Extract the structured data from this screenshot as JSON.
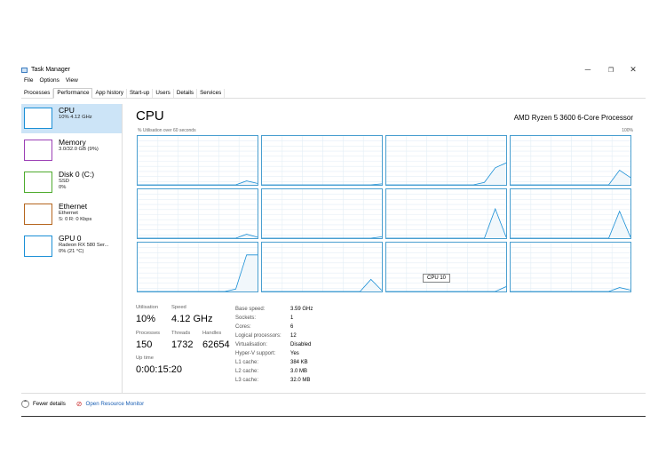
{
  "window": {
    "title": "Task Manager",
    "minimize": "─",
    "maximize": "❐",
    "close": "✕"
  },
  "menu": [
    "File",
    "Options",
    "View"
  ],
  "tabs": [
    "Processes",
    "Performance",
    "App history",
    "Start-up",
    "Users",
    "Details",
    "Services"
  ],
  "active_tab": 1,
  "sidebar": [
    {
      "title": "CPU",
      "sub1": "10% 4.12 GHz",
      "sub2": "",
      "color": "#1a8fd6"
    },
    {
      "title": "Memory",
      "sub1": "3.0/32.0 GB (9%)",
      "sub2": "",
      "color": "#9b3fb5"
    },
    {
      "title": "Disk 0 (C:)",
      "sub1": "SSD",
      "sub2": "0%",
      "color": "#4daa2c"
    },
    {
      "title": "Ethernet",
      "sub1": "Ethernet",
      "sub2": "S: 0 R: 0 Kbps",
      "color": "#b5651d"
    },
    {
      "title": "GPU 0",
      "sub1": "Radeon RX 580 Ser...",
      "sub2": "0% (21 °C)",
      "color": "#1a8fd6"
    }
  ],
  "main": {
    "title": "CPU",
    "processor": "AMD Ryzen 5 3600 6-Core Processor",
    "axis_label": "% Utilisation over 60 seconds",
    "axis_max": "100%",
    "tooltip": "CPU 10",
    "cores": [
      [
        0,
        0,
        0,
        0,
        0,
        0,
        0,
        0,
        0,
        0,
        8,
        3
      ],
      [
        0,
        0,
        0,
        0,
        0,
        0,
        0,
        0,
        0,
        0,
        0,
        2
      ],
      [
        0,
        0,
        0,
        0,
        0,
        0,
        0,
        0,
        0,
        5,
        35,
        45
      ],
      [
        0,
        0,
        0,
        0,
        0,
        0,
        0,
        0,
        0,
        0,
        30,
        15
      ],
      [
        0,
        0,
        0,
        0,
        0,
        0,
        0,
        0,
        0,
        0,
        8,
        2
      ],
      [
        0,
        0,
        0,
        0,
        0,
        0,
        0,
        0,
        0,
        0,
        0,
        3
      ],
      [
        0,
        0,
        0,
        0,
        0,
        0,
        0,
        0,
        0,
        0,
        60,
        2
      ],
      [
        0,
        0,
        0,
        0,
        0,
        0,
        0,
        0,
        0,
        0,
        55,
        2
      ],
      [
        0,
        0,
        0,
        0,
        0,
        0,
        0,
        0,
        0,
        5,
        75,
        75
      ],
      [
        0,
        0,
        0,
        0,
        0,
        0,
        0,
        0,
        0,
        0,
        25,
        2
      ],
      [
        0,
        0,
        0,
        0,
        0,
        0,
        0,
        0,
        0,
        0,
        0,
        10
      ],
      [
        0,
        0,
        0,
        0,
        0,
        0,
        0,
        0,
        0,
        0,
        8,
        3
      ]
    ],
    "stats": {
      "utilisation_label": "Utilisation",
      "utilisation": "10%",
      "speed_label": "Speed",
      "speed": "4.12 GHz",
      "processes_label": "Processes",
      "processes": "150",
      "threads_label": "Threads",
      "threads": "1732",
      "handles_label": "Handles",
      "handles": "62654",
      "uptime_label": "Up time",
      "uptime": "0:00:15:20"
    },
    "info": [
      [
        "Base speed:",
        "3.59 GHz"
      ],
      [
        "Sockets:",
        "1"
      ],
      [
        "Cores:",
        "6"
      ],
      [
        "Logical processors:",
        "12"
      ],
      [
        "Virtualisation:",
        "Disabled"
      ],
      [
        "Hyper-V support:",
        "Yes"
      ],
      [
        "L1 cache:",
        "384 KB"
      ],
      [
        "L2 cache:",
        "3.0 MB"
      ],
      [
        "L3 cache:",
        "32.0 MB"
      ]
    ]
  },
  "footer": {
    "fewer": "Fewer details",
    "monitor": "Open Resource Monitor"
  }
}
